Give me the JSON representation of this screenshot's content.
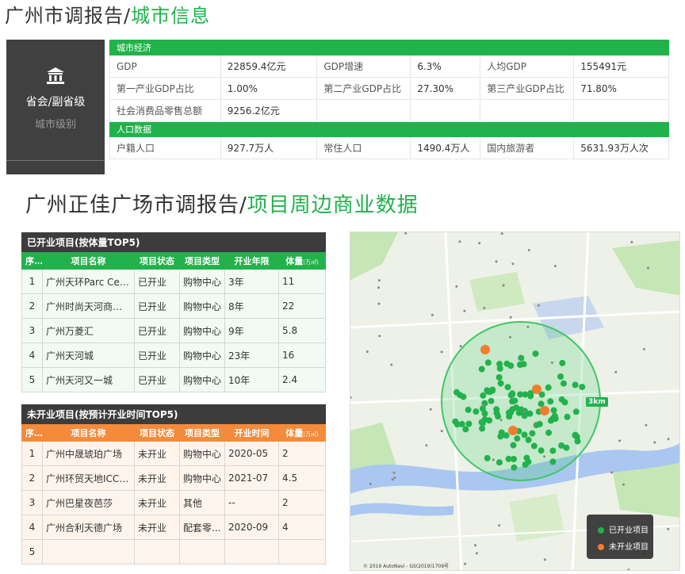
{
  "section1": {
    "title_prefix": "广州市调报告/",
    "title_highlight": "城市信息"
  },
  "city_level": {
    "value": "省会/副省级",
    "label": "城市级别",
    "icon": "bank-icon"
  },
  "economy": {
    "section_label": "城市经济",
    "gdp_label": "GDP",
    "gdp_value": "22859.4亿元",
    "gdp_growth_label": "GDP增速",
    "gdp_growth_value": "6.3%",
    "gdp_per_capita_label": "人均GDP",
    "gdp_per_capita_value": "155491元",
    "primary_label": "第一产业GDP占比",
    "primary_value": "1.00%",
    "secondary_label": "第二产业GDP占比",
    "secondary_value": "27.30%",
    "tertiary_label": "第三产业GDP占比",
    "tertiary_value": "71.80%",
    "retail_label": "社会消费品零售总额",
    "retail_value": "9256.2亿元"
  },
  "population": {
    "section_label": "人口数据",
    "registered_label": "户籍人口",
    "registered_value": "927.7万人",
    "resident_label": "常住人口",
    "resident_value": "1490.4万人",
    "tourist_label": "国内旅游者",
    "tourist_value": "5631.93万人次"
  },
  "section2": {
    "title_prefix": "广州正佳广场市调报告/",
    "title_highlight": "项目周边商业数据"
  },
  "open_projects": {
    "title": "已开业项目(按体量TOP5)",
    "headers": {
      "no": "序号",
      "name": "项目名称",
      "status": "项目状态",
      "type": "项目类型",
      "years": "开业年限",
      "volume": "体量",
      "unit": "(万㎡)"
    },
    "rows": [
      {
        "no": "1",
        "name": "广州天环Parc Cen...",
        "status": "已开业",
        "type": "购物中心",
        "years": "3年",
        "volume": "11"
      },
      {
        "no": "2",
        "name": "广州时尚天河商业...",
        "status": "已开业",
        "type": "购物中心",
        "years": "8年",
        "volume": "22"
      },
      {
        "no": "3",
        "name": "广州万菱汇",
        "status": "已开业",
        "type": "购物中心",
        "years": "9年",
        "volume": "5.8"
      },
      {
        "no": "4",
        "name": "广州天河城",
        "status": "已开业",
        "type": "购物中心",
        "years": "23年",
        "volume": "16"
      },
      {
        "no": "5",
        "name": "广州天河又一城",
        "status": "已开业",
        "type": "购物中心",
        "years": "10年",
        "volume": "2.4"
      }
    ]
  },
  "planned_projects": {
    "title": "未开业项目(按预计开业时间TOP5)",
    "headers": {
      "no": "序号",
      "name": "项目名称",
      "status": "项目状态",
      "type": "项目类型",
      "time": "开业时间",
      "volume": "体量",
      "unit": "(万㎡)"
    },
    "rows": [
      {
        "no": "1",
        "name": "广州中晟琥珀广场",
        "status": "未开业",
        "type": "购物中心",
        "time": "2020-05",
        "volume": "2"
      },
      {
        "no": "2",
        "name": "广州环贸天地ICC ...",
        "status": "未开业",
        "type": "购物中心",
        "time": "2021-07",
        "volume": "4.5"
      },
      {
        "no": "3",
        "name": "广州巴星夜芭莎",
        "status": "未开业",
        "type": "其他",
        "time": "--",
        "volume": "2"
      },
      {
        "no": "4",
        "name": "广州合利天德广场",
        "status": "未开业",
        "type": "配套零...",
        "time": "2020-09",
        "volume": "4"
      },
      {
        "no": "5",
        "name": "",
        "status": "",
        "type": "",
        "time": "",
        "volume": ""
      }
    ]
  },
  "map": {
    "radius_label": "3km",
    "legend_open": "已开业项目",
    "legend_planned": "未开业项目",
    "copyright": "© 2019 AutoNavi - GS(2019)1709号",
    "colors": {
      "open": "#21b24c",
      "planned": "#f07d2d",
      "circle": "#3cc864",
      "river": "#a9c7f0"
    }
  }
}
